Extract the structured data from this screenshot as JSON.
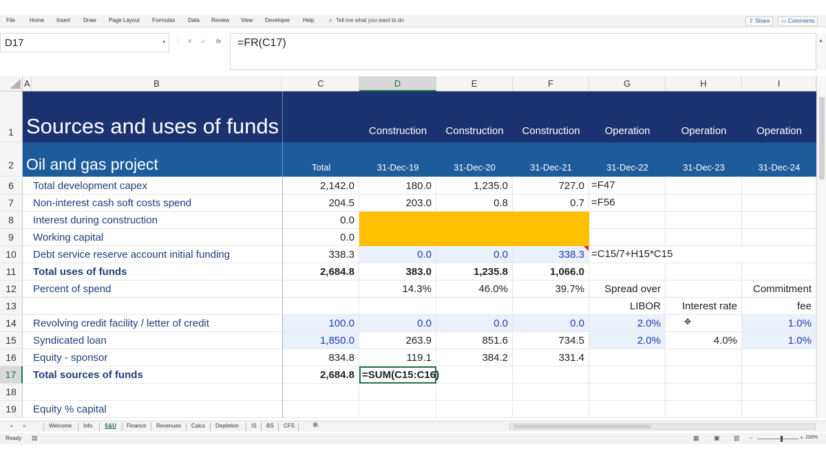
{
  "ribbon": {
    "menus": [
      "File",
      "Home",
      "Insert",
      "Draw",
      "Page Layout",
      "Formulas",
      "Data",
      "Review",
      "View",
      "Developer",
      "Help"
    ],
    "tell_me": "Tell me what you want to do",
    "share": "Share",
    "comments": "Comments"
  },
  "formula_bar": {
    "name_box": "D17",
    "formula": "=FR(C17)"
  },
  "columns": [
    "A",
    "B",
    "C",
    "D",
    "E",
    "F",
    "G",
    "H",
    "I"
  ],
  "active_column": "D",
  "rows": [
    "1",
    "2",
    "6",
    "7",
    "8",
    "9",
    "10",
    "11",
    "12",
    "13",
    "14",
    "15",
    "16",
    "17",
    "18",
    "19"
  ],
  "active_row": "17",
  "sheet": {
    "title": "Sources and uses of funds",
    "subtitle": "Oil and gas project",
    "phases": [
      "Construction",
      "Construction",
      "Construction",
      "Operation",
      "Operation",
      "Operation"
    ],
    "dates": [
      "Total",
      "31-Dec-19",
      "31-Dec-20",
      "31-Dec-21",
      "31-Dec-22",
      "31-Dec-23",
      "31-Dec-24"
    ],
    "r6": {
      "label": "Total development capex",
      "c": "2,142.0",
      "d": "180.0",
      "e": "1,235.0",
      "f": "727.0",
      "note": "=F47"
    },
    "r7": {
      "label": "Non-interest cash soft costs spend",
      "c": "204.5",
      "d": "203.0",
      "e": "0.8",
      "f": "0.7",
      "note": "=F56"
    },
    "r8": {
      "label": "Interest during construction",
      "c": "0.0"
    },
    "r9": {
      "label": "Working capital",
      "c": "0.0"
    },
    "r10": {
      "label": "Debt service reserve account initial funding",
      "c": "338.3",
      "d": "0.0",
      "e": "0.0",
      "f": "338.3",
      "note": "=C15/7+H15*C15"
    },
    "r11": {
      "label": "Total uses of funds",
      "c": "2,684.8",
      "d": "383.0",
      "e": "1,235.8",
      "f": "1,066.0"
    },
    "r12": {
      "label": "Percent of spend",
      "d": "14.3%",
      "e": "46.0%",
      "f": "39.7%",
      "g": "Spread over",
      "i": "Commitment"
    },
    "r13": {
      "g": "LIBOR",
      "h": "Interest rate",
      "i": "fee"
    },
    "r14": {
      "label": "Revolving credit facility / letter of credit",
      "c": "100.0",
      "d": "0.0",
      "e": "0.0",
      "f": "0.0",
      "g": "2.0%",
      "i": "1.0%"
    },
    "r15": {
      "label": "Syndicated loan",
      "c": "1,850.0",
      "d": "263.9",
      "e": "851.6",
      "f": "734.5",
      "g": "2.0%",
      "h": "4.0%",
      "i": "1.0%"
    },
    "r16": {
      "label": "Equity - sponsor",
      "c": "834.8",
      "d": "119.1",
      "e": "384.2",
      "f": "331.4"
    },
    "r17": {
      "label": "Total sources of funds",
      "c": "2,684.8",
      "d_edit": "=SUM(C15:C16)"
    },
    "r19": {
      "label": "Equity % capital"
    }
  },
  "tabs": [
    "Welcome",
    "Info",
    "S&U",
    "Finance",
    "Revenues",
    "Calcs",
    "Depletion",
    "IS",
    "BS",
    "CFS"
  ],
  "active_tab": "S&U",
  "status": {
    "ready": "Ready",
    "zoom": "200%"
  },
  "colors": {
    "title_band": "#1a3370",
    "header_band": "#1e5b9b",
    "highlight": "#ffc000",
    "excel_green": "#217346",
    "input_blue": "#1f3ab5"
  }
}
